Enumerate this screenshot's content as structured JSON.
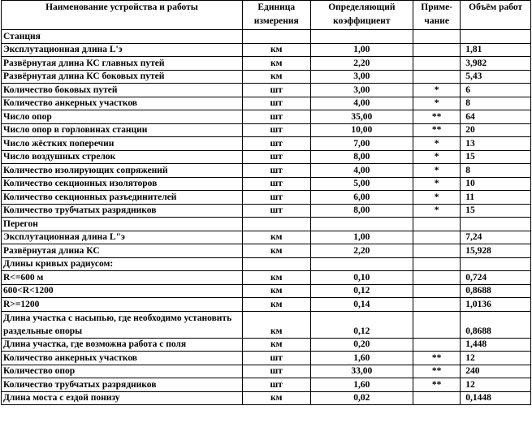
{
  "headers": [
    "Наименование устройства и работы",
    "Единица измерения",
    "Определяющий коэффициент",
    "Приме-чание",
    "Объём работ"
  ],
  "sections": [
    {
      "title": "Станция",
      "rows": [
        {
          "name": "Эксплутационная длина L'э",
          "unit": "км",
          "coef": "1,00",
          "note": "",
          "volume": "1,81"
        },
        {
          "name": "Развёрнутая длина КС главных путей",
          "unit": "км",
          "coef": "2,20",
          "note": "",
          "volume": "3,982"
        },
        {
          "name": "Развёрнутая длина КС боковых путей",
          "unit": "км",
          "coef": "3,00",
          "note": "",
          "volume": "5,43"
        },
        {
          "name": "Количество боковых путей",
          "unit": "шт",
          "coef": "3,00",
          "note": "*",
          "volume": "6"
        },
        {
          "name": "Количество анкерных участков",
          "unit": "шт",
          "coef": "4,00",
          "note": "*",
          "volume": "8"
        },
        {
          "name": "Число опор",
          "unit": "шт",
          "coef": "35,00",
          "note": "**",
          "volume": "64"
        },
        {
          "name": "Число опор в горловинах станции",
          "unit": "шт",
          "coef": "10,00",
          "note": "**",
          "volume": "20"
        },
        {
          "name": "Число жёстких поперечин",
          "unit": "шт",
          "coef": "7,00",
          "note": "*",
          "volume": "13"
        },
        {
          "name": "Число воздушных стрелок",
          "unit": "шт",
          "coef": "8,00",
          "note": "*",
          "volume": "15"
        },
        {
          "name": "Количество изолирующих сопряжений",
          "unit": "шт",
          "coef": "4,00",
          "note": "*",
          "volume": "8"
        },
        {
          "name": "Количество секционных изоляторов",
          "unit": "шт",
          "coef": "5,00",
          "note": "*",
          "volume": "10"
        },
        {
          "name": "Количество секционных разъединителей",
          "unit": "шт",
          "coef": "6,00",
          "note": "*",
          "volume": "11"
        },
        {
          "name": "Количество трубчатых разрядников",
          "unit": "шт",
          "coef": "8,00",
          "note": "*",
          "volume": "15"
        }
      ]
    },
    {
      "title": "Перегон",
      "rows": [
        {
          "name": "Эксплутационная длина L\"э",
          "unit": "км",
          "coef": "1,00",
          "note": "",
          "volume": "7,24"
        },
        {
          "name": "Развёрнутая длина КС",
          "unit": "км",
          "coef": "2,20",
          "note": "",
          "volume": "15,928"
        },
        {
          "name": "Длины кривых радиусом:",
          "unit": "",
          "coef": "",
          "note": "",
          "volume": ""
        },
        {
          "name": "R<=600 м",
          "unit": "км",
          "coef": "0,10",
          "note": "",
          "volume": "0,724"
        },
        {
          "name": "600<R<1200",
          "unit": "км",
          "coef": "0,12",
          "note": "",
          "volume": "0,8688"
        },
        {
          "name": "R>=1200",
          "unit": "км",
          "coef": "0,14",
          "note": "",
          "volume": "1,0136"
        },
        {
          "name": "Длина участка с насыпью, где необходимо установить раздельные опоры",
          "unit": "км",
          "coef": "0,12",
          "note": "",
          "volume": "0,8688",
          "tall": true
        },
        {
          "name": "Длина участка, где возможна работа с поля",
          "unit": "км",
          "coef": "0,20",
          "note": "",
          "volume": "1,448"
        },
        {
          "name": "Количество анкерных участков",
          "unit": "шт",
          "coef": "1,60",
          "note": "**",
          "volume": "12"
        },
        {
          "name": "Количество опор",
          "unit": "шт",
          "coef": "33,00",
          "note": "**",
          "volume": "240"
        },
        {
          "name": "Количество трубчатых разрядников",
          "unit": "шт",
          "coef": "1,60",
          "note": "**",
          "volume": "12"
        },
        {
          "name": "Длина моста с ездой понизу",
          "unit": "км",
          "coef": "0,02",
          "note": "",
          "volume": "0,1448"
        }
      ]
    }
  ]
}
